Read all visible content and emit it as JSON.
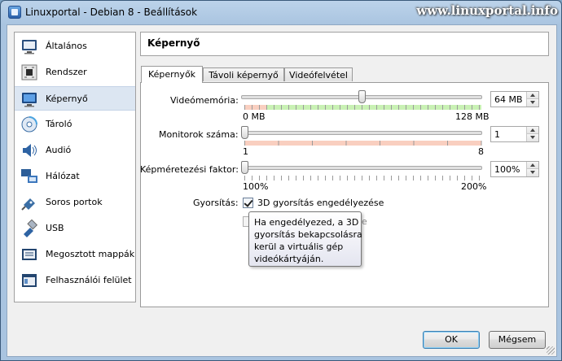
{
  "window": {
    "title": "Linuxportal - Debian 8 - Beállítások",
    "watermark": "www.linuxportal.info"
  },
  "sidebar": {
    "items": [
      {
        "label": "Általános",
        "icon": "monitor-general-icon"
      },
      {
        "label": "Rendszer",
        "icon": "chip-system-icon"
      },
      {
        "label": "Képernyő",
        "icon": "display-icon",
        "selected": true
      },
      {
        "label": "Tároló",
        "icon": "disk-storage-icon"
      },
      {
        "label": "Audió",
        "icon": "speaker-icon"
      },
      {
        "label": "Hálózat",
        "icon": "network-icon"
      },
      {
        "label": "Soros portok",
        "icon": "serial-port-icon"
      },
      {
        "label": "USB",
        "icon": "usb-icon"
      },
      {
        "label": "Megosztott mappák",
        "icon": "shared-folder-icon"
      },
      {
        "label": "Felhasználói felület",
        "icon": "user-interface-icon"
      }
    ]
  },
  "page": {
    "title": "Képernyő"
  },
  "tabs": [
    {
      "label": "Képernyők",
      "active": true
    },
    {
      "label": "Távoli képernyő",
      "active": false
    },
    {
      "label": "Videófelvétel",
      "active": false
    }
  ],
  "settings": {
    "video_memory": {
      "label": "Videómemória:",
      "value": 64,
      "value_text": "64 MB",
      "min": 0,
      "max": 128,
      "min_label": "0 MB",
      "max_label": "128 MB"
    },
    "monitor_count": {
      "label": "Monitorok száma:",
      "value": 1,
      "value_text": "1",
      "min": 1,
      "max": 8,
      "min_label": "1",
      "max_label": "8"
    },
    "scale_factor": {
      "label": "Képméretezési faktor:",
      "value": 100,
      "value_text": "100%",
      "min": 100,
      "max": 200,
      "min_label": "100%",
      "max_label": "200%"
    },
    "acceleration": {
      "label": "Gyorsítás:",
      "accel_3d": {
        "label": "3D gyorsítás engedélyezése",
        "checked": true
      },
      "accel_2d": {
        "label": "2D videógyorsítás engedélyezése",
        "visible_fragment": "e",
        "checked": false,
        "enabled": false
      }
    }
  },
  "tooltip": {
    "text": "Ha engedélyezed, a 3D\ngyorsítás bekapcsolásra\nkerül a virtuális gép\nvideókártyáján."
  },
  "buttons": {
    "ok": "OK",
    "cancel": "Mégsem"
  },
  "colors": {
    "band_green": "#c9f1b4",
    "band_red": "#f9cfc0",
    "selection": "#dce6f2"
  }
}
